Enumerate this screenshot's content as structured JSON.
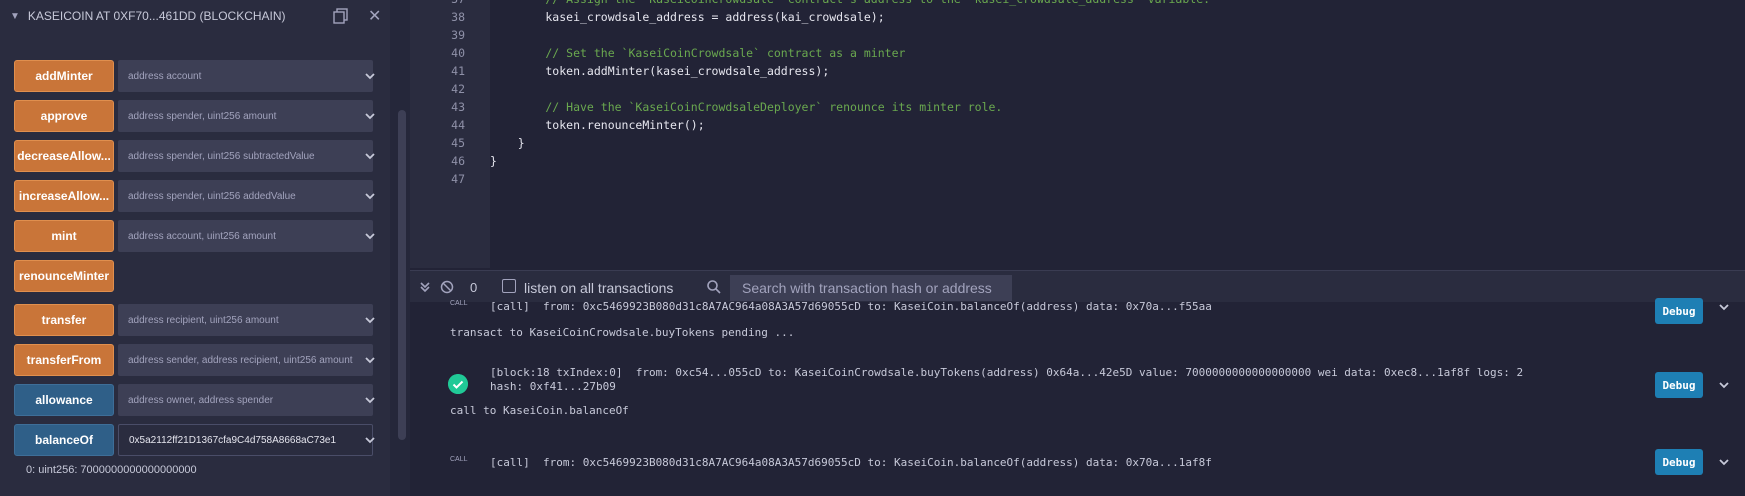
{
  "contract_header": {
    "title": "KASEICOIN AT 0XF70...461DD (BLOCKCHAIN)"
  },
  "functions": [
    {
      "label": "addMinter",
      "placeholder": "address account",
      "color": "orange"
    },
    {
      "label": "approve",
      "placeholder": "address spender, uint256 amount",
      "color": "orange"
    },
    {
      "label": "decreaseAllow...",
      "placeholder": "address spender, uint256 subtractedValue",
      "color": "orange"
    },
    {
      "label": "increaseAllow...",
      "placeholder": "address spender, uint256 addedValue",
      "color": "orange"
    },
    {
      "label": "mint",
      "placeholder": "address account, uint256 amount",
      "color": "orange"
    },
    {
      "label": "renounceMinter",
      "placeholder": "",
      "color": "orange"
    },
    {
      "label": "transfer",
      "placeholder": "address recipient, uint256 amount",
      "color": "orange"
    },
    {
      "label": "transferFrom",
      "placeholder": "address sender, address recipient, uint256 amount",
      "color": "orange"
    },
    {
      "label": "allowance",
      "placeholder": "address owner, address spender",
      "color": "blue"
    },
    {
      "label": "balanceOf",
      "value": "0x5a2112ff21D1367cfa9C4d758A8668aC73e1",
      "color": "blue"
    }
  ],
  "result": "0: uint256: 7000000000000000000",
  "editor": {
    "lines": [
      {
        "n": "37",
        "text": "        // Assign the `KaseiCoinCrowdsale` contract's address to the `kasei_crowdsale_address` variable.",
        "type": "comment"
      },
      {
        "n": "38",
        "text": "        kasei_crowdsale_address = address(kai_crowdsale);",
        "type": "code"
      },
      {
        "n": "39",
        "text": "",
        "type": "code"
      },
      {
        "n": "40",
        "text": "        // Set the `KaseiCoinCrowdsale` contract as a minter",
        "type": "comment"
      },
      {
        "n": "41",
        "text": "        token.addMinter(kasei_crowdsale_address);",
        "type": "code"
      },
      {
        "n": "42",
        "text": "",
        "type": "code"
      },
      {
        "n": "43",
        "text": "        // Have the `KaseiCoinCrowdsaleDeployer` renounce its minter role.",
        "type": "comment"
      },
      {
        "n": "44",
        "text": "        token.renounceMinter();",
        "type": "code"
      },
      {
        "n": "45",
        "text": "    }",
        "type": "code"
      },
      {
        "n": "46",
        "text": "}",
        "type": "code"
      },
      {
        "n": "47",
        "text": "",
        "type": "code"
      }
    ]
  },
  "terminal_bar": {
    "count": "0",
    "listen_label": "listen on all transactions",
    "search_placeholder": "Search with transaction hash or address"
  },
  "terminal": {
    "call_tag": "CALL",
    "call1": "[call]  from: 0xc5469923B080d31c8A7AC964a08A3A57d69055cD to: KaseiCoin.balanceOf(address) data: 0x70a...f55aa",
    "pending": "transact to KaseiCoinCrowdsale.buyTokens pending ...",
    "block_line1": "[block:18 txIndex:0]  from: 0xc54...055cD to: KaseiCoinCrowdsale.buyTokens(address) 0x64a...42e5D value: 7000000000000000000 wei data: 0xec8...1af8f logs: 2",
    "block_line2": "hash: 0xf41...27b09",
    "call_to": "call to KaseiCoin.balanceOf",
    "call2": "[call]  from: 0xc5469923B080d31c8A7AC964a08A3A57d69055cD to: KaseiCoin.balanceOf(address) data: 0x70a...1af8f",
    "debug_label": "Debug"
  }
}
